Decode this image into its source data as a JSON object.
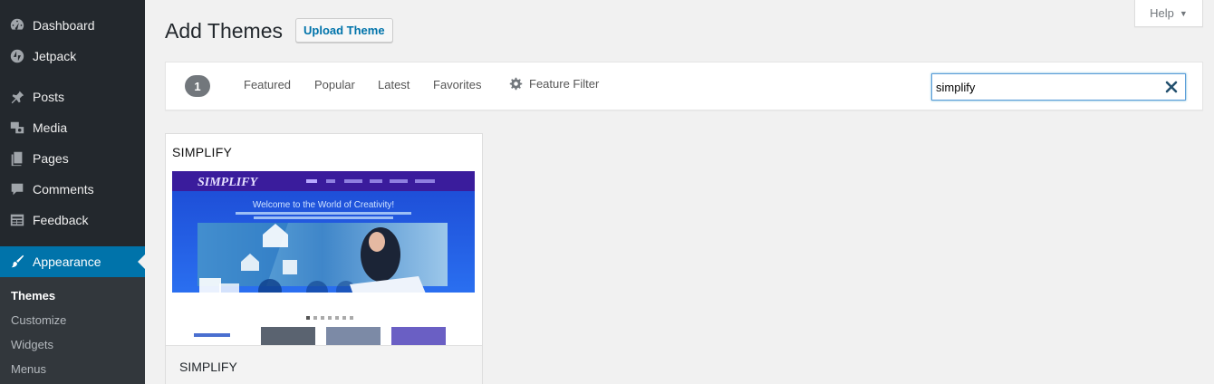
{
  "sidebar": {
    "items": [
      {
        "label": "Dashboard",
        "icon": "dashboard-icon"
      },
      {
        "label": "Jetpack",
        "icon": "jetpack-icon"
      },
      {
        "label": "Posts",
        "icon": "pushpin-icon"
      },
      {
        "label": "Media",
        "icon": "media-icon"
      },
      {
        "label": "Pages",
        "icon": "pages-icon"
      },
      {
        "label": "Comments",
        "icon": "comment-icon"
      },
      {
        "label": "Feedback",
        "icon": "feedback-icon"
      },
      {
        "label": "Appearance",
        "icon": "paintbrush-icon",
        "current": true
      }
    ],
    "submenu": [
      {
        "label": "Themes",
        "current": true
      },
      {
        "label": "Customize"
      },
      {
        "label": "Widgets"
      },
      {
        "label": "Menus"
      }
    ]
  },
  "help_tab": {
    "label": "Help"
  },
  "header": {
    "title": "Add Themes",
    "upload_label": "Upload Theme"
  },
  "filter_bar": {
    "count": "1",
    "links": [
      "Featured",
      "Popular",
      "Latest",
      "Favorites"
    ],
    "feature_filter_label": "Feature Filter",
    "search_value": "simplify"
  },
  "theme": {
    "title_overlay": "SIMPLIFY",
    "name": "SIMPLIFY"
  },
  "colors": {
    "sidebar_bg": "#23282d",
    "accent": "#0073aa",
    "submenu_bg": "#32373c",
    "page_bg": "#f1f1f1"
  }
}
